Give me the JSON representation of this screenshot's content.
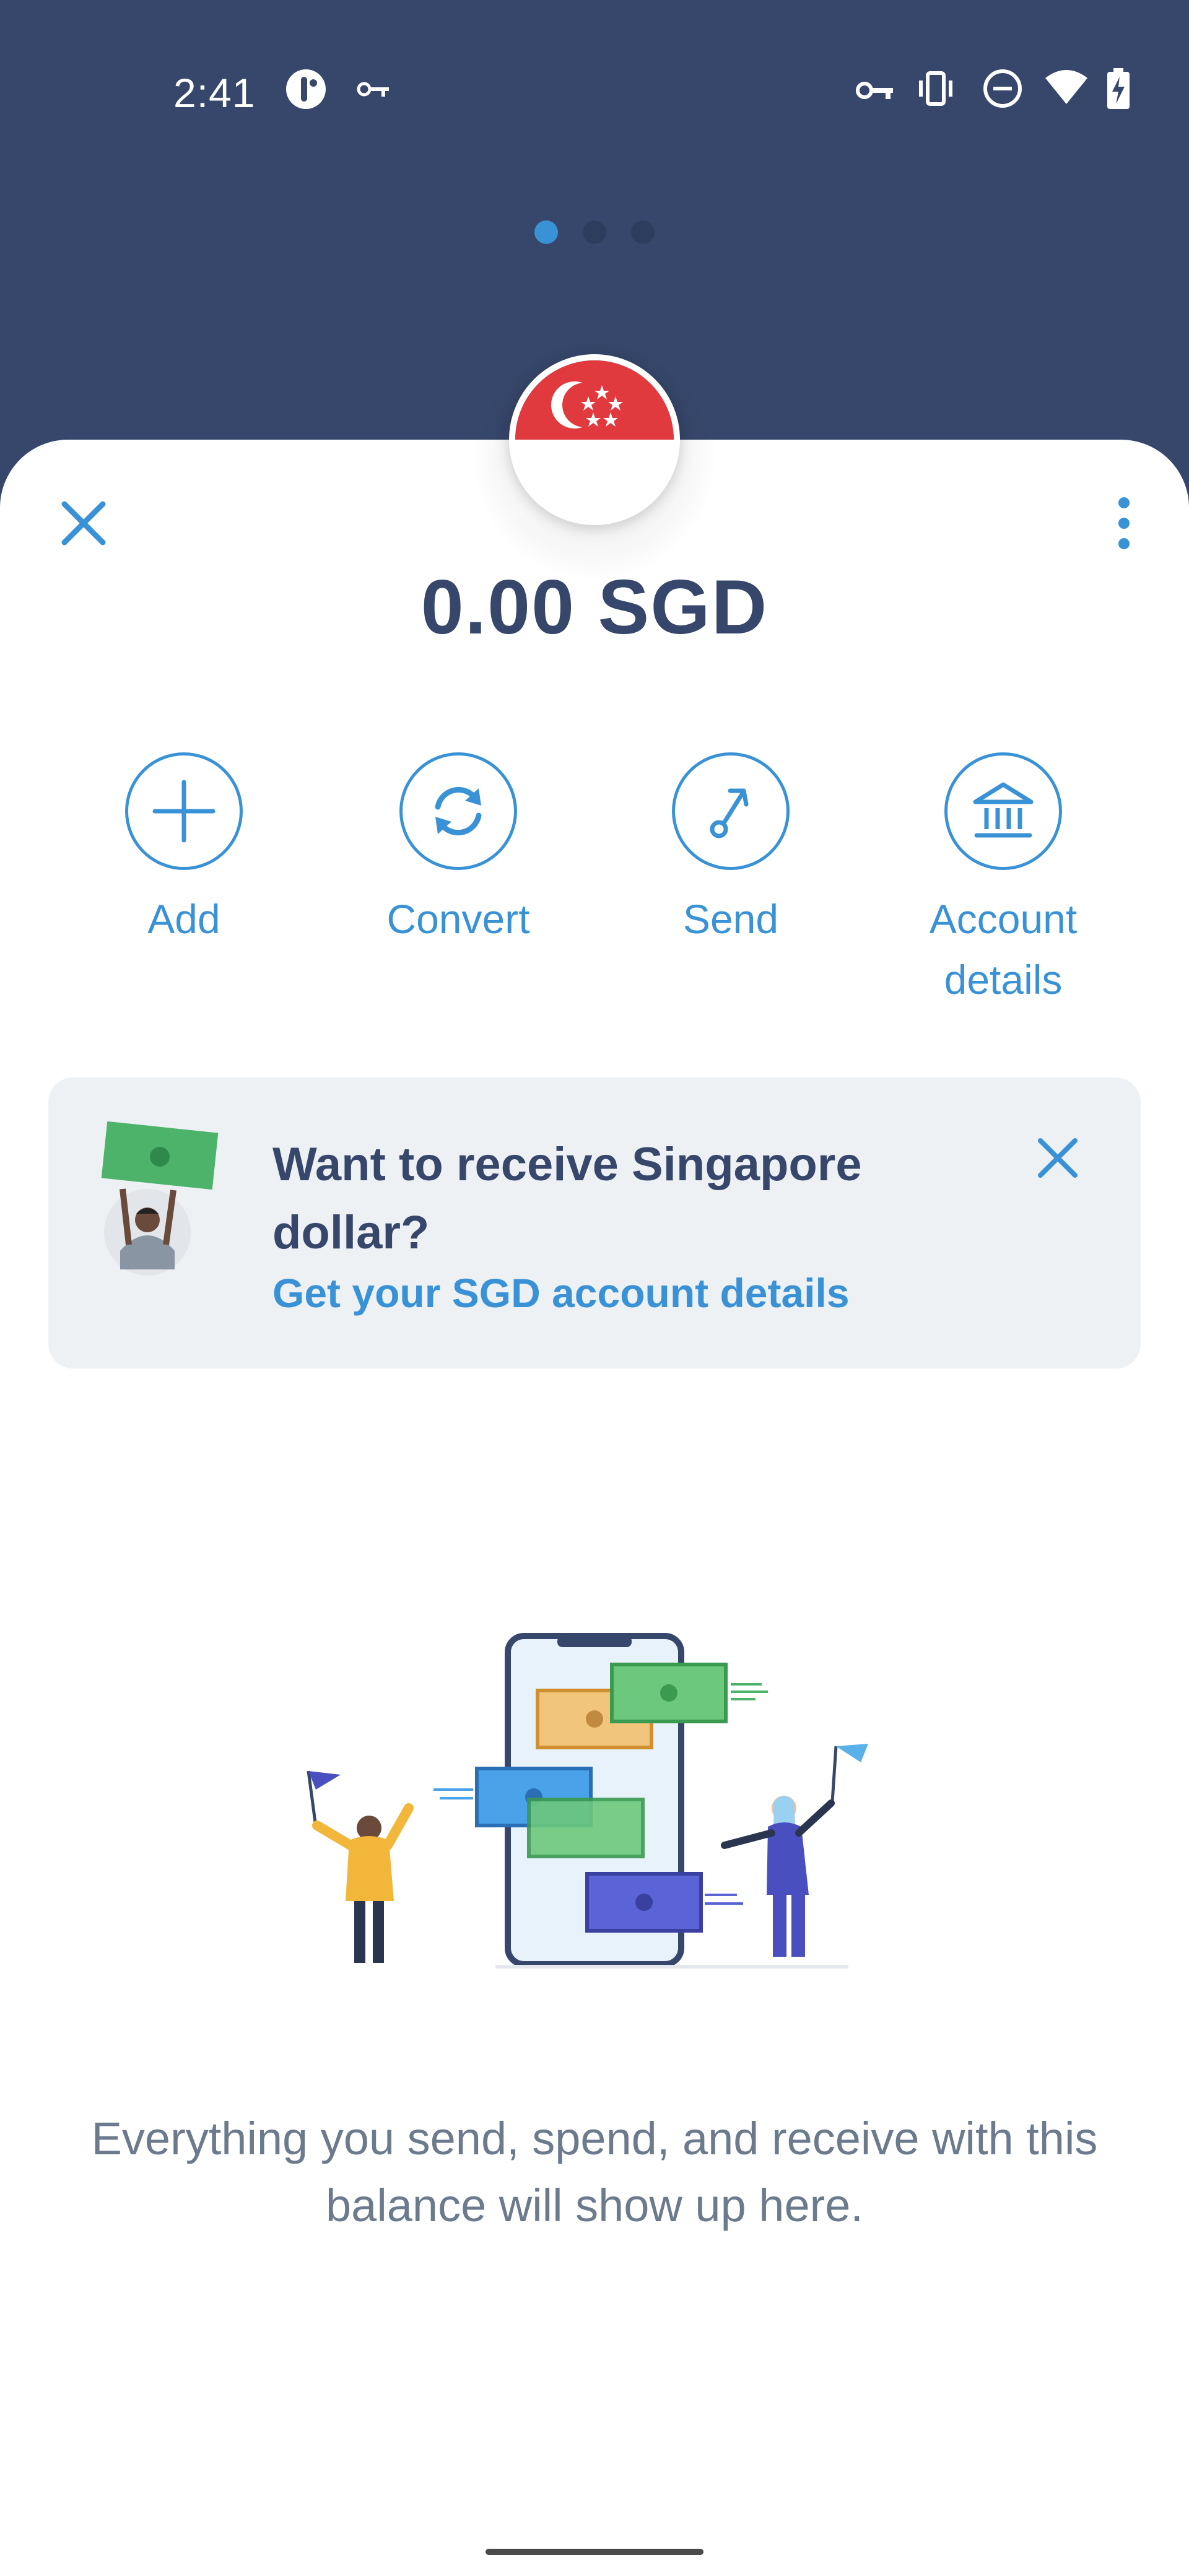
{
  "status_bar": {
    "time": "2:41",
    "icons": [
      "app-icon",
      "key-icon",
      "vpn-key-icon",
      "vibrate-icon",
      "do-not-disturb-icon",
      "wifi-icon",
      "battery-charging-icon"
    ]
  },
  "pager": {
    "count": 3,
    "active_index": 0
  },
  "header": {
    "flag": "singapore-flag",
    "balance": "0.00 SGD"
  },
  "actions": [
    {
      "label": "Add",
      "icon": "plus-icon"
    },
    {
      "label": "Convert",
      "icon": "refresh-icon"
    },
    {
      "label": "Send",
      "icon": "send-arrow-icon"
    },
    {
      "label": "Account details",
      "label_line1": "Account",
      "label_line2": "details",
      "icon": "bank-icon"
    }
  ],
  "banner": {
    "title": "Want to receive Singapore dollar?",
    "link": "Get your SGD account details"
  },
  "empty_state": {
    "text": "Everything you send, spend, and receive with this balance will show up here."
  },
  "colors": {
    "header_bg": "#37476b",
    "accent": "#3a92d6",
    "text_dark": "#37476b",
    "text_muted": "#6c7a8d",
    "banner_bg": "#edf1f4"
  }
}
